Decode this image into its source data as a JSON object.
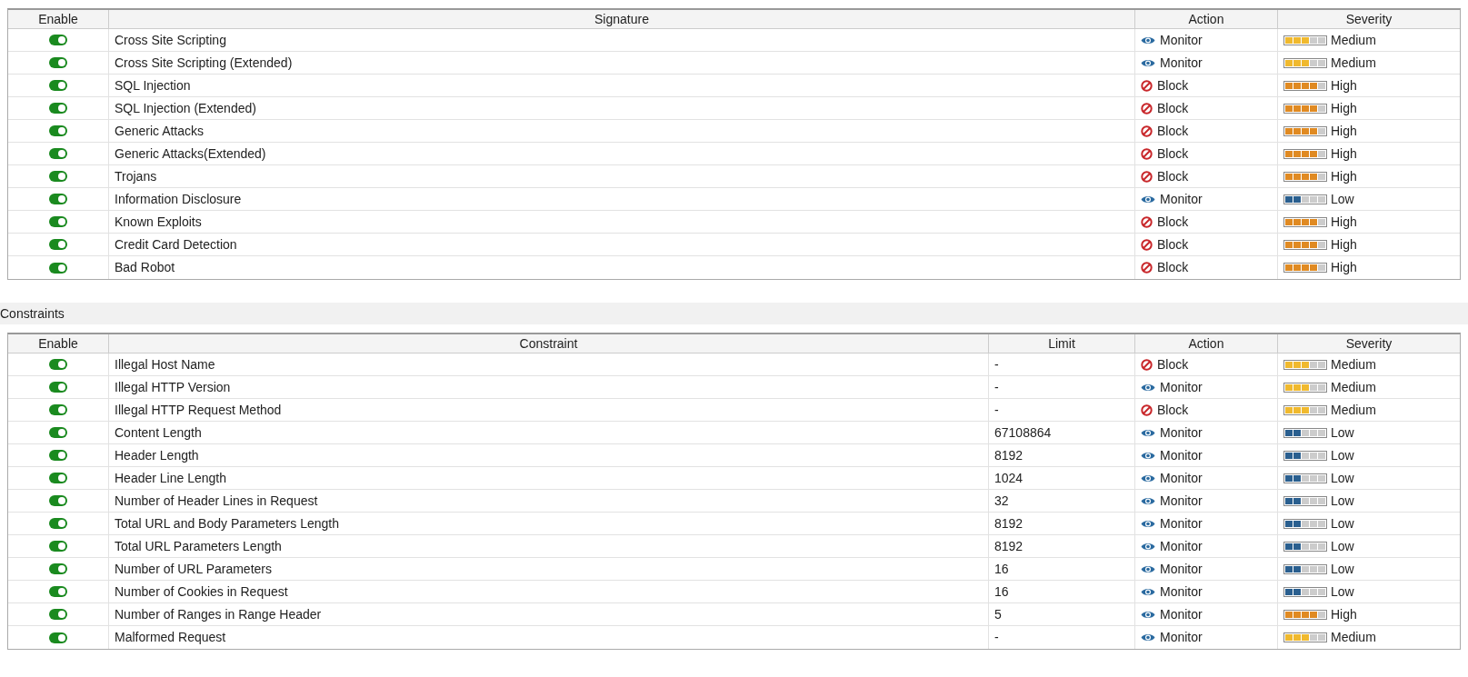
{
  "signatures": {
    "columns": [
      "Enable",
      "Signature",
      "Action",
      "Severity"
    ],
    "rows": [
      {
        "enabled": true,
        "name": "Cross Site Scripting",
        "action": {
          "kind": "monitor",
          "label": "Monitor"
        },
        "severity": {
          "label": "Medium",
          "level": 0.6,
          "color": "#f0b92e"
        }
      },
      {
        "enabled": true,
        "name": "Cross Site Scripting (Extended)",
        "action": {
          "kind": "monitor",
          "label": "Monitor"
        },
        "severity": {
          "label": "Medium",
          "level": 0.6,
          "color": "#f0b92e"
        }
      },
      {
        "enabled": true,
        "name": "SQL Injection",
        "action": {
          "kind": "block",
          "label": "Block"
        },
        "severity": {
          "label": "High",
          "level": 0.8,
          "color": "#e08a22"
        }
      },
      {
        "enabled": true,
        "name": "SQL Injection (Extended)",
        "action": {
          "kind": "block",
          "label": "Block"
        },
        "severity": {
          "label": "High",
          "level": 0.8,
          "color": "#e08a22"
        }
      },
      {
        "enabled": true,
        "name": "Generic Attacks",
        "action": {
          "kind": "block",
          "label": "Block"
        },
        "severity": {
          "label": "High",
          "level": 0.8,
          "color": "#e08a22"
        }
      },
      {
        "enabled": true,
        "name": "Generic Attacks(Extended)",
        "action": {
          "kind": "block",
          "label": "Block"
        },
        "severity": {
          "label": "High",
          "level": 0.8,
          "color": "#e08a22"
        }
      },
      {
        "enabled": true,
        "name": "Trojans",
        "action": {
          "kind": "block",
          "label": "Block"
        },
        "severity": {
          "label": "High",
          "level": 0.8,
          "color": "#e08a22"
        }
      },
      {
        "enabled": true,
        "name": "Information Disclosure",
        "action": {
          "kind": "monitor",
          "label": "Monitor"
        },
        "severity": {
          "label": "Low",
          "level": 0.4,
          "color": "#2a5f8f"
        }
      },
      {
        "enabled": true,
        "name": "Known Exploits",
        "action": {
          "kind": "block",
          "label": "Block"
        },
        "severity": {
          "label": "High",
          "level": 0.8,
          "color": "#e08a22"
        }
      },
      {
        "enabled": true,
        "name": "Credit Card Detection",
        "action": {
          "kind": "block",
          "label": "Block"
        },
        "severity": {
          "label": "High",
          "level": 0.8,
          "color": "#e08a22"
        }
      },
      {
        "enabled": true,
        "name": "Bad Robot",
        "action": {
          "kind": "block",
          "label": "Block"
        },
        "severity": {
          "label": "High",
          "level": 0.8,
          "color": "#e08a22"
        }
      }
    ]
  },
  "constraints_title": "Constraints",
  "constraints": {
    "columns": [
      "Enable",
      "Constraint",
      "Limit",
      "Action",
      "Severity"
    ],
    "rows": [
      {
        "enabled": true,
        "name": "Illegal Host Name",
        "limit": "-",
        "action": {
          "kind": "block",
          "label": "Block"
        },
        "severity": {
          "label": "Medium",
          "level": 0.6,
          "color": "#f0b92e"
        }
      },
      {
        "enabled": true,
        "name": "Illegal HTTP Version",
        "limit": "-",
        "action": {
          "kind": "monitor",
          "label": "Monitor"
        },
        "severity": {
          "label": "Medium",
          "level": 0.6,
          "color": "#f0b92e"
        }
      },
      {
        "enabled": true,
        "name": "Illegal HTTP Request Method",
        "limit": "-",
        "action": {
          "kind": "block",
          "label": "Block"
        },
        "severity": {
          "label": "Medium",
          "level": 0.6,
          "color": "#f0b92e"
        }
      },
      {
        "enabled": true,
        "name": "Content Length",
        "limit": "67108864",
        "action": {
          "kind": "monitor",
          "label": "Monitor"
        },
        "severity": {
          "label": "Low",
          "level": 0.4,
          "color": "#2a5f8f"
        }
      },
      {
        "enabled": true,
        "name": "Header Length",
        "limit": "8192",
        "action": {
          "kind": "monitor",
          "label": "Monitor"
        },
        "severity": {
          "label": "Low",
          "level": 0.4,
          "color": "#2a5f8f"
        }
      },
      {
        "enabled": true,
        "name": "Header Line Length",
        "limit": "1024",
        "action": {
          "kind": "monitor",
          "label": "Monitor"
        },
        "severity": {
          "label": "Low",
          "level": 0.4,
          "color": "#2a5f8f"
        }
      },
      {
        "enabled": true,
        "name": "Number of Header Lines in Request",
        "limit": "32",
        "action": {
          "kind": "monitor",
          "label": "Monitor"
        },
        "severity": {
          "label": "Low",
          "level": 0.4,
          "color": "#2a5f8f"
        }
      },
      {
        "enabled": true,
        "name": "Total URL and Body Parameters Length",
        "limit": "8192",
        "action": {
          "kind": "monitor",
          "label": "Monitor"
        },
        "severity": {
          "label": "Low",
          "level": 0.4,
          "color": "#2a5f8f"
        }
      },
      {
        "enabled": true,
        "name": "Total URL Parameters Length",
        "limit": "8192",
        "action": {
          "kind": "monitor",
          "label": "Monitor"
        },
        "severity": {
          "label": "Low",
          "level": 0.4,
          "color": "#2a5f8f"
        }
      },
      {
        "enabled": true,
        "name": "Number of URL Parameters",
        "limit": "16",
        "action": {
          "kind": "monitor",
          "label": "Monitor"
        },
        "severity": {
          "label": "Low",
          "level": 0.4,
          "color": "#2a5f8f"
        }
      },
      {
        "enabled": true,
        "name": "Number of Cookies in Request",
        "limit": "16",
        "action": {
          "kind": "monitor",
          "label": "Monitor"
        },
        "severity": {
          "label": "Low",
          "level": 0.4,
          "color": "#2a5f8f"
        }
      },
      {
        "enabled": true,
        "name": "Number of Ranges in Range Header",
        "limit": "5",
        "action": {
          "kind": "monitor",
          "label": "Monitor"
        },
        "severity": {
          "label": "High",
          "level": 0.8,
          "color": "#e08a22"
        }
      },
      {
        "enabled": true,
        "name": "Malformed Request",
        "limit": "-",
        "action": {
          "kind": "monitor",
          "label": "Monitor"
        },
        "severity": {
          "label": "Medium",
          "level": 0.6,
          "color": "#f0b92e"
        }
      }
    ]
  }
}
